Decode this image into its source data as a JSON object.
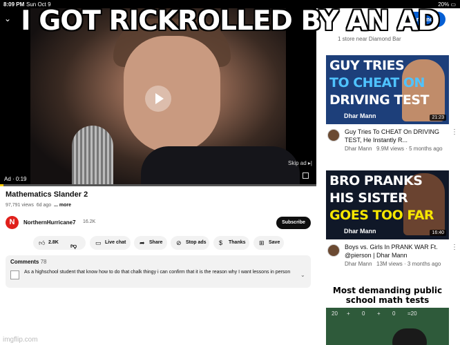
{
  "meme": {
    "caption": "I GOT RICKROLLED BY AN AD",
    "watermark": "imgflip.com"
  },
  "status_bar": {
    "time": "8:09 PM",
    "date": "Sun Oct 9",
    "battery": "20%"
  },
  "player": {
    "ad_label": "Ad · 0:19",
    "skip_label": "Skip ad",
    "progress": 0.0
  },
  "ad_card": {
    "learn_more": "arn more",
    "store_text": "1 store near Diamond Bar"
  },
  "video": {
    "title": "Mathematics Slander 2",
    "views": "97,791 views",
    "age": "6d ago",
    "more": "... more",
    "channel_initial": "N",
    "channel": "NorthernHurricane7",
    "subscribers": "16.2K",
    "subscribe_label": "Subscribe"
  },
  "actions": {
    "likes": "2.8K",
    "live_chat": "Live chat",
    "share": "Share",
    "stop_ads": "Stop ads",
    "thanks": "Thanks",
    "save": "Save"
  },
  "comments": {
    "label": "Comments",
    "count": "78",
    "top_comment": "As a highschool student that know how to do that chalk thingy i can confirm that it is the reason why I want lessons in person"
  },
  "recommended": [
    {
      "thumb_lines": [
        "GUY TRIES",
        "TO CHEAT ON",
        "DRIVING TEST"
      ],
      "thumb_person": "Dhar Mann",
      "duration": "21:23",
      "title": "Guy Tries To CHEAT On DRIVING TEST, He Instantly R...",
      "channel": "Dhar Mann",
      "stats": "9.9M views · 5 months ago"
    },
    {
      "thumb_lines": [
        "BRO PRANKS",
        "HIS SISTER",
        "GOES TOO FAR"
      ],
      "thumb_person": "Dhar Mann",
      "duration": "16:40",
      "title": "Boys vs. Girls In PRANK WAR Ft. @pierson | Dhar Mann",
      "channel": "Dhar Mann",
      "stats": "13M views · 3 months ago"
    },
    {
      "thumb_lines": [
        "Most demanding public",
        "school math tests"
      ],
      "board_text": [
        "20",
        "+",
        "0",
        "+",
        "0",
        "=20"
      ]
    }
  ],
  "colors": {
    "accent": "#065fd4",
    "progress": "#ffcc00",
    "dhar_yellow": "#f6e600"
  }
}
